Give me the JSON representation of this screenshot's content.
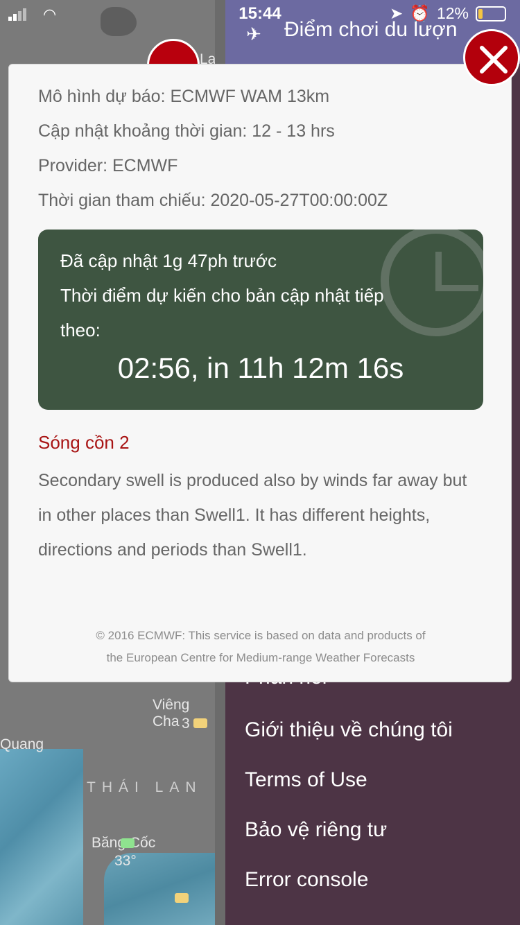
{
  "status_bar": {
    "time": "15:44",
    "battery": "12%"
  },
  "map": {
    "labels": [
      "Viêng Cha",
      "3",
      "Quang",
      "THÁI LAN",
      "Băng Cốc",
      "33°",
      "La"
    ]
  },
  "menu": {
    "top_item": "Điểm chơi du lượn",
    "partial_item": "Phản hồi",
    "items": [
      "Giới thiệu về chúng tôi",
      "Terms of Use",
      "Bảo vệ riêng tư",
      "Error console"
    ]
  },
  "dialog": {
    "model": "Mô hình dự báo: ECMWF WAM 13km",
    "update_interval": "Cập nhật khoảng thời gian: 12 - 13 hrs",
    "provider": "Provider: ECMWF",
    "reference_time": "Thời gian tham chiếu: 2020-05-27T00:00:00Z",
    "updated_ago": "Đã cập nhật 1g 47ph trước",
    "next_update_label_1": "Thời điểm dự kiến cho bản cập nhật tiếp",
    "next_update_label_2": "theo:",
    "countdown": "02:56, in 11h 12m 16s",
    "layer_title": "Sóng cồn 2",
    "layer_description": "Secondary swell is produced also by winds far away but in other places than Swell1. It has different heights, directions and periods than Swell1.",
    "copyright_1": "© 2016 ECMWF: This service is based on data and products of",
    "copyright_2": "the European Centre for Medium-range Weather Forecasts"
  },
  "colors": {
    "accent_red": "#b3000c",
    "update_box": "#3e5541",
    "menu_bg": "#4d3445",
    "title_red": "#a81414"
  }
}
